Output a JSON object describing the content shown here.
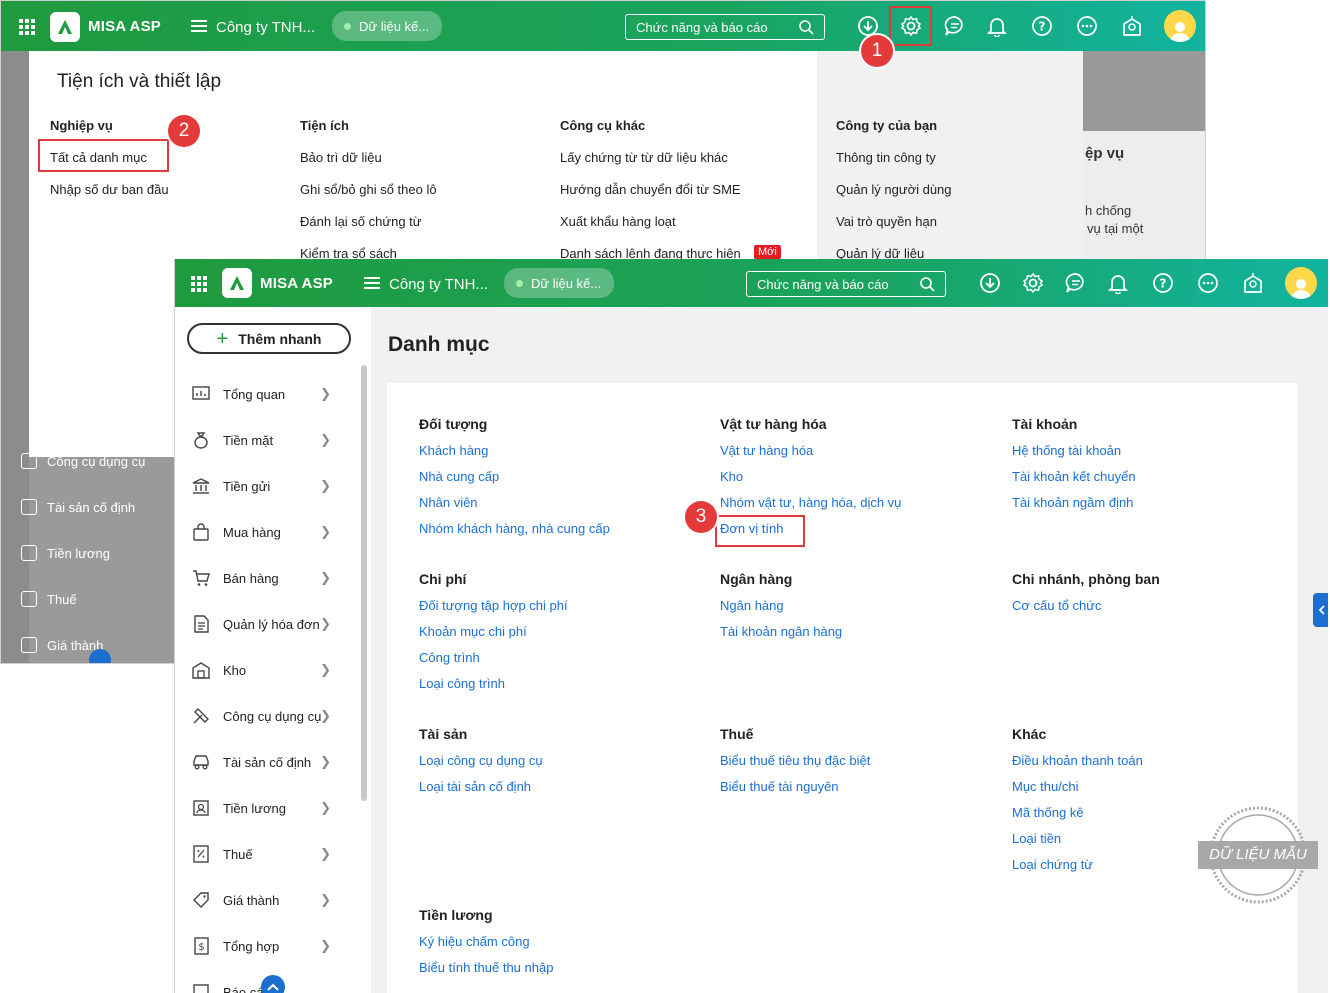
{
  "back_window": {
    "app_name": "MISA ASP",
    "company": "Công ty TNH...",
    "data_pill": "Dữ liệu kế...",
    "search_placeholder": "Chức năng và báo cáo",
    "panel_title": "Tiện ích và thiết lập",
    "columns": [
      {
        "header": "Nghiệp vụ",
        "items": [
          "Tất cả danh mục",
          "Nhập số dư ban đầu"
        ]
      },
      {
        "header": "Tiện ích",
        "items": [
          "Bảo trì dữ liệu",
          "Ghi sổ/bỏ ghi sổ theo lô",
          "Đánh lại số chứng từ",
          "Kiểm tra sổ sách"
        ]
      },
      {
        "header": "Công cụ khác",
        "items": [
          "Lấy chứng từ từ dữ liệu khác",
          "Hướng dẫn chuyển đổi từ SME",
          "Xuất khẩu hàng loạt",
          "Danh sách lệnh đang thực hiện"
        ]
      },
      {
        "header": "Công ty của bạn",
        "items": [
          "Thông tin công ty",
          "Quản lý người dùng",
          "Vai trò quyền hạn",
          "Quản lý dữ liệu"
        ]
      }
    ],
    "new_badge": "Mới",
    "bg_snippets": [
      "ệp vụ",
      "h chống",
      "vụ tại một"
    ],
    "bg_sidebar": [
      "Công cụ dụng cụ",
      "Tài sản cố định",
      "Tiền lương",
      "Thuế",
      "Giá thành"
    ]
  },
  "front_window": {
    "app_name": "MISA ASP",
    "company": "Công ty TNH...",
    "data_pill": "Dữ liệu kế...",
    "search_placeholder": "Chức năng và báo cáo",
    "quick_add": "Thêm nhanh",
    "nav": [
      "Tổng quan",
      "Tiền mặt",
      "Tiền gửi",
      "Mua hàng",
      "Bán hàng",
      "Quản lý hóa đơn",
      "Kho",
      "Công cụ dụng cụ",
      "Tài sản cố định",
      "Tiền lương",
      "Thuế",
      "Giá thành",
      "Tổng hợp",
      "Báo cáo"
    ],
    "page_title": "Danh mục",
    "groups": [
      {
        "title": "Đối tượng",
        "links": [
          "Khách hàng",
          "Nhà cung cấp",
          "Nhân viên",
          "Nhóm khách hàng, nhà cung cấp"
        ]
      },
      {
        "title": "Vật tư hàng hóa",
        "links": [
          "Vật tư hàng hóa",
          "Kho",
          "Nhóm vật tư, hàng hóa, dịch vụ",
          "Đơn vị tính"
        ]
      },
      {
        "title": "Tài khoản",
        "links": [
          "Hệ thống tài khoản",
          "Tài khoản kết chuyển",
          "Tài khoản ngầm định"
        ]
      },
      {
        "title": "Chi phí",
        "links": [
          "Đối tượng tập hợp chi phí",
          "Khoản mục chi phí",
          "Công trình",
          "Loại công trình"
        ]
      },
      {
        "title": "Ngân hàng",
        "links": [
          "Ngân hàng",
          "Tài khoản ngân hàng"
        ]
      },
      {
        "title": "Chi nhánh, phòng ban",
        "links": [
          "Cơ cấu tổ chức"
        ]
      },
      {
        "title": "Tài sản",
        "links": [
          "Loại công cụ dụng cụ",
          "Loại tài sản cố định"
        ]
      },
      {
        "title": "Thuế",
        "links": [
          "Biểu thuế tiêu thụ đặc biệt",
          "Biểu thuế tài nguyên"
        ]
      },
      {
        "title": "Khác",
        "links": [
          "Điều khoản thanh toán",
          "Mục thu/chi",
          "Mã thống kê",
          "Loại tiền",
          "Loại chứng từ"
        ]
      },
      {
        "title": "Tiền lương",
        "links": [
          "Ký hiệu chấm công",
          "Biểu tính thuế thu nhập"
        ]
      }
    ]
  },
  "steps": [
    "1",
    "2",
    "3"
  ],
  "watermark": "DỮ LIỆU MẪU",
  "colors": {
    "brand_green": "#1f9a3e",
    "brand_teal": "#12b3a0",
    "link_blue": "#1b6fd1",
    "highlight_red": "#e03b3b"
  }
}
